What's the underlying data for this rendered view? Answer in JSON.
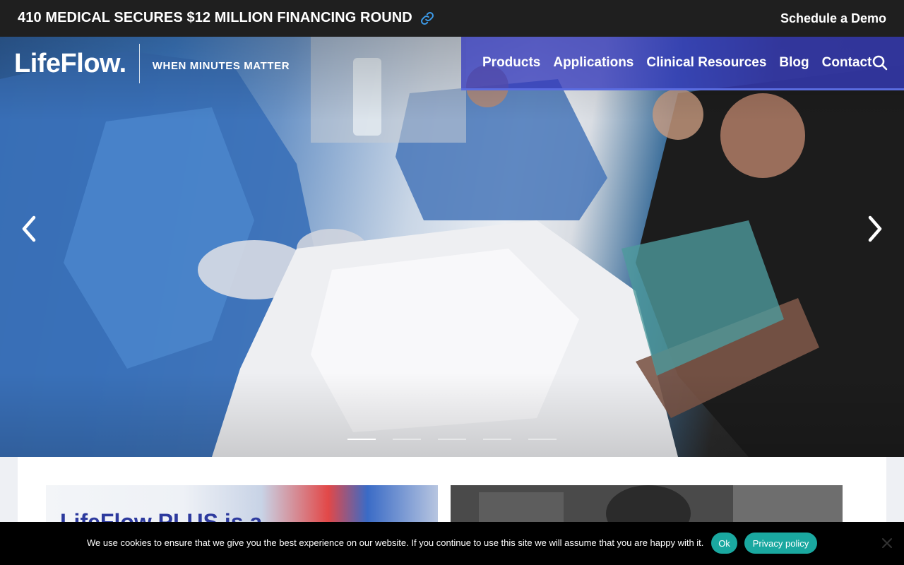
{
  "announcement": {
    "headline": "410 MEDICAL SECURES $12 MILLION FINANCING ROUND",
    "link_icon": "link-icon",
    "demo_label": "Schedule a Demo"
  },
  "header": {
    "logo": "LifeFlow.",
    "tagline": "WHEN MINUTES MATTER",
    "nav": [
      "Products",
      "Applications",
      "Clinical Resources",
      "Blog",
      "Contact"
    ],
    "search_icon": "search-icon",
    "nav_color": "#3c41c0"
  },
  "hero": {
    "prev_icon": "chevron-left-icon",
    "next_icon": "chevron-right-icon",
    "slide_count": 5,
    "active_slide": 1
  },
  "content": {
    "card_one_title": "LifeFlow PLUS is a",
    "title_color": "#2d3a9e"
  },
  "cookie": {
    "message": "We use cookies to ensure that we give you the best experience on our website. If you continue to use this site we will assume that you are happy with it.",
    "ok_label": "Ok",
    "privacy_label": "Privacy policy",
    "close_icon": "close-icon",
    "button_color": "#1aa8a0"
  }
}
